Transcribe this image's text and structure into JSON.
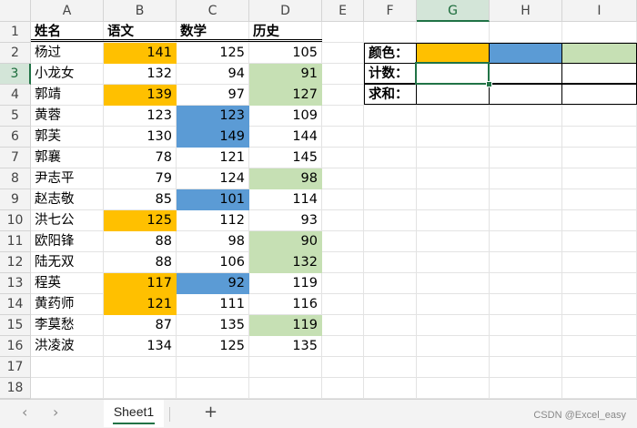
{
  "columns": [
    "A",
    "B",
    "C",
    "D",
    "E",
    "F",
    "G",
    "H",
    "I"
  ],
  "rows": [
    "1",
    "2",
    "3",
    "4",
    "5",
    "6",
    "7",
    "8",
    "9",
    "10",
    "11",
    "12",
    "13",
    "14",
    "15",
    "16",
    "17",
    "18"
  ],
  "selected_cell": {
    "column": "G",
    "row": "3"
  },
  "headers": [
    "姓名",
    "语文",
    "数学",
    "历史"
  ],
  "students": [
    {
      "name": "杨过",
      "chinese": 141,
      "math": 125,
      "history": 105
    },
    {
      "name": "小龙女",
      "chinese": 132,
      "math": 94,
      "history": 91
    },
    {
      "name": "郭靖",
      "chinese": 139,
      "math": 97,
      "history": 127
    },
    {
      "name": "黄蓉",
      "chinese": 123,
      "math": 123,
      "history": 109
    },
    {
      "name": "郭芙",
      "chinese": 130,
      "math": 149,
      "history": 144
    },
    {
      "name": "郭襄",
      "chinese": 78,
      "math": 121,
      "history": 145
    },
    {
      "name": "尹志平",
      "chinese": 79,
      "math": 124,
      "history": 98
    },
    {
      "name": "赵志敬",
      "chinese": 85,
      "math": 101,
      "history": 114
    },
    {
      "name": "洪七公",
      "chinese": 125,
      "math": 112,
      "history": 93
    },
    {
      "name": "欧阳锋",
      "chinese": 88,
      "math": 98,
      "history": 90
    },
    {
      "name": "陆无双",
      "chinese": 88,
      "math": 106,
      "history": 132
    },
    {
      "name": "程英",
      "chinese": 117,
      "math": 92,
      "history": 119
    },
    {
      "name": "黄药师",
      "chinese": 121,
      "math": 111,
      "history": 116
    },
    {
      "name": "李莫愁",
      "chinese": 87,
      "math": 135,
      "history": 119
    },
    {
      "name": "洪凌波",
      "chinese": 134,
      "math": 125,
      "history": 135
    }
  ],
  "highlights": {
    "chinese": [
      0,
      2,
      8,
      11,
      12
    ],
    "math": [
      3,
      4,
      7,
      11
    ],
    "history": [
      1,
      2,
      6,
      9,
      10,
      13
    ]
  },
  "colors": {
    "orange": "#ffc000",
    "blue": "#5b9bd5",
    "green": "#c6e0b4",
    "accent": "#217346"
  },
  "summary": {
    "color_label": "颜色：",
    "count_label": "计数：",
    "sum_label": "求和："
  },
  "sheet_tab": "Sheet1",
  "add_sheet": "+",
  "nav_prev": "‹",
  "nav_next": "›",
  "watermark": "CSDN @Excel_easy"
}
